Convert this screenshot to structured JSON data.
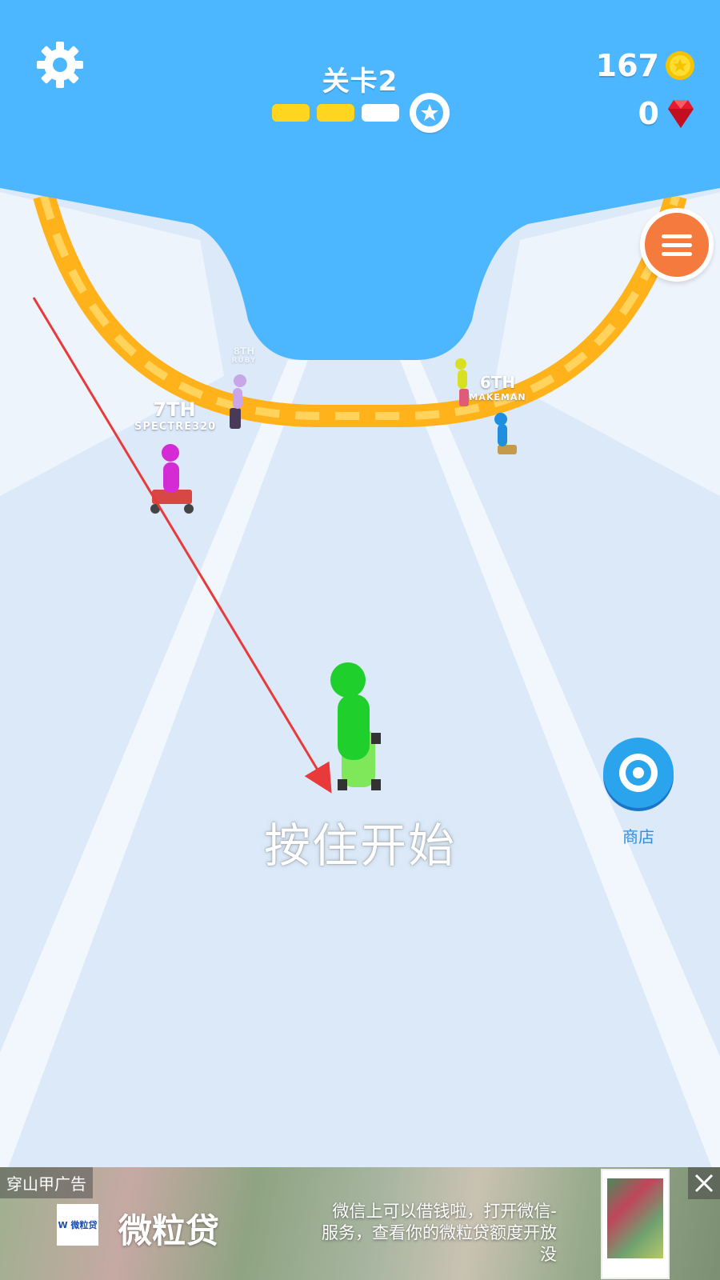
{
  "hud": {
    "level_title": "关卡2",
    "progress": {
      "completed_stages": 2,
      "total_stages": 3
    },
    "coins": "167",
    "gems": "0"
  },
  "racers": [
    {
      "rank": "7TH",
      "name": "SPECTRE320",
      "color": "#d42bd4"
    },
    {
      "rank": "6TH",
      "name": "MAKEMAN",
      "color": "#1e8ee0"
    },
    {
      "rank": "8TH",
      "name": "RUBY",
      "color": "#c9a6e8"
    }
  ],
  "prompt": {
    "hold_to_start": "按住开始"
  },
  "shop": {
    "label": "商店",
    "icon": "tire-icon"
  },
  "menu": {
    "icon": "menu-icon"
  },
  "ad": {
    "tag": "穿山甲广告",
    "logo_text": "W 微粒贷",
    "brand": "微粒贷",
    "description": "微信上可以借钱啦，打开微信-服务，查看你的微粒贷额度开放没"
  },
  "colors": {
    "sky": "#4cb6ff",
    "track": "#d8e8f8",
    "track_edge": "#ffb21a",
    "player": "#1fcf2b",
    "progress_done": "#ffd51f",
    "progress_todo": "#ffffff",
    "menu_button": "#f47a3e",
    "guide_arrow": "#e83a3a"
  }
}
